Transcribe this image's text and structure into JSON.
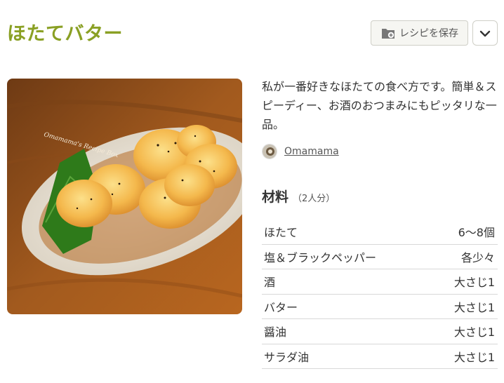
{
  "recipe": {
    "title": "ほたてバター",
    "save_label": "レシピを保存",
    "description": "私が一番好きなほたての食べ方です。簡単＆スピーディー、お酒のおつまみにもピッタリな一品。",
    "author": "Omamama",
    "photo_watermark": "Omamama's Recipe Box"
  },
  "ingredients": {
    "title": "材料",
    "servings": "（2人分）",
    "items": [
      {
        "name": "ほたて",
        "qty": "6～8個"
      },
      {
        "name": "塩＆ブラックペッパー",
        "qty": "各少々"
      },
      {
        "name": "酒",
        "qty": "大さじ1"
      },
      {
        "name": "バター",
        "qty": "大さじ1"
      },
      {
        "name": "醤油",
        "qty": "大さじ1"
      },
      {
        "name": "サラダ油",
        "qty": "大さじ1"
      }
    ]
  },
  "colors": {
    "title": "#8aa024",
    "text": "#333333",
    "divider": "#d8d8d8"
  },
  "icons": {
    "save": "folder-add-icon",
    "more": "chevron-down-icon"
  }
}
